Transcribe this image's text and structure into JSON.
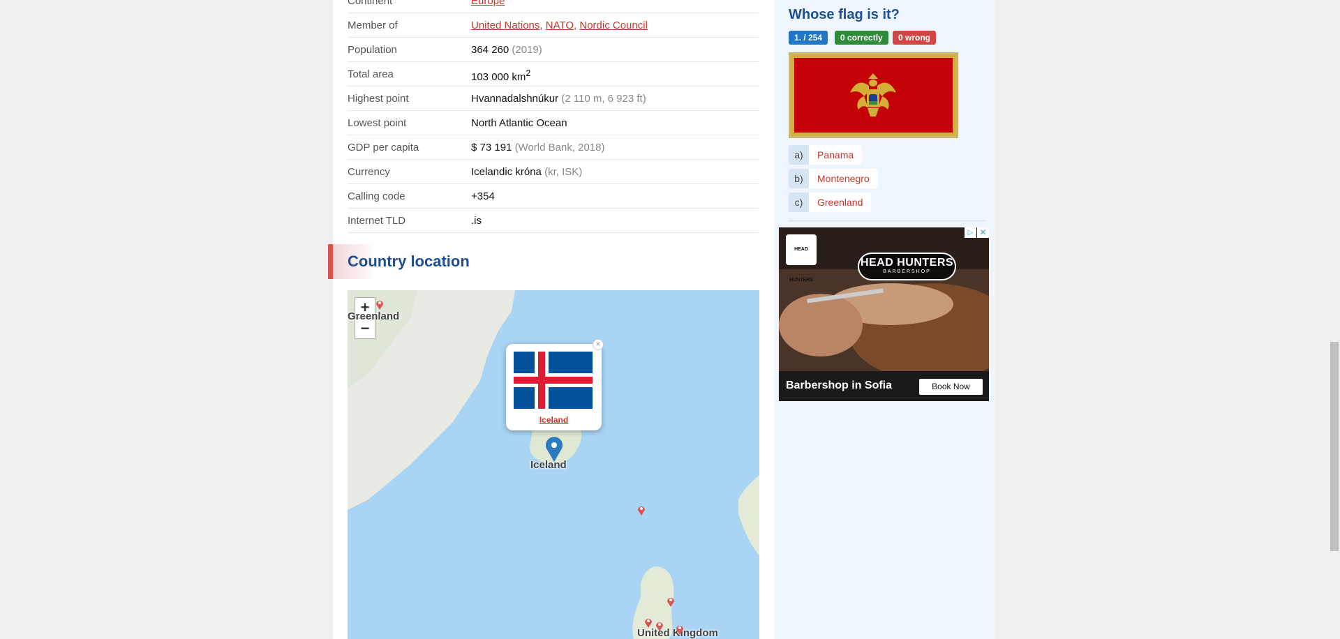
{
  "facts": [
    {
      "label": "Continent",
      "value": "",
      "links": [
        "Europe"
      ],
      "note": ""
    },
    {
      "label": "Member of",
      "value": "",
      "links": [
        "United Nations",
        "NATO",
        "Nordic Council"
      ],
      "note": ""
    },
    {
      "label": "Population",
      "value": "364 260",
      "links": [],
      "note": "(2019)"
    },
    {
      "label": "Total area",
      "value": "103 000 km",
      "sup": "2",
      "links": [],
      "note": ""
    },
    {
      "label": "Highest point",
      "value": "Hvannadalshnúkur",
      "links": [],
      "note": "(2 110 m, 6 923 ft)"
    },
    {
      "label": "Lowest point",
      "value": "North Atlantic Ocean",
      "links": [],
      "note": ""
    },
    {
      "label": "GDP per capita",
      "value": "$ 73 191",
      "links": [],
      "note": "(World Bank, 2018)"
    },
    {
      "label": "Currency",
      "value": "Icelandic króna",
      "links": [],
      "note": "(kr, ISK)"
    },
    {
      "label": "Calling code",
      "value": "+354",
      "links": [],
      "note": ""
    },
    {
      "label": "Internet TLD",
      "value": ".is",
      "links": [],
      "note": ""
    }
  ],
  "location": {
    "title": "Country location",
    "zoom_in": "+",
    "zoom_out": "−",
    "labels": {
      "greenland": "Greenland",
      "iceland": "Iceland",
      "uk": "United Kingdom"
    },
    "popup": {
      "close": "×",
      "link": "Iceland"
    }
  },
  "quiz": {
    "title": "Whose flag is it?",
    "progress": "1. / 254",
    "correct": "0  correctly",
    "wrong": "0  wrong",
    "answers": [
      {
        "letter": "a)",
        "text": "Panama"
      },
      {
        "letter": "b)",
        "text": "Montenegro"
      },
      {
        "letter": "c)",
        "text": "Greenland"
      }
    ]
  },
  "ad": {
    "logo": "HEAD HUNTERS",
    "brand": "HEAD HUNTERS",
    "brand_sub": "BARBERSHOP",
    "text": "Barbershop in Sofia",
    "button": "Book Now",
    "choices_icon": "ad-choices-icon",
    "close_icon": "close-icon"
  },
  "colors": {
    "accent": "#1f4e8c",
    "link": "#c0392b",
    "badge_blue": "#2176c7",
    "badge_green": "#2e8b3a",
    "badge_red": "#d14545"
  }
}
